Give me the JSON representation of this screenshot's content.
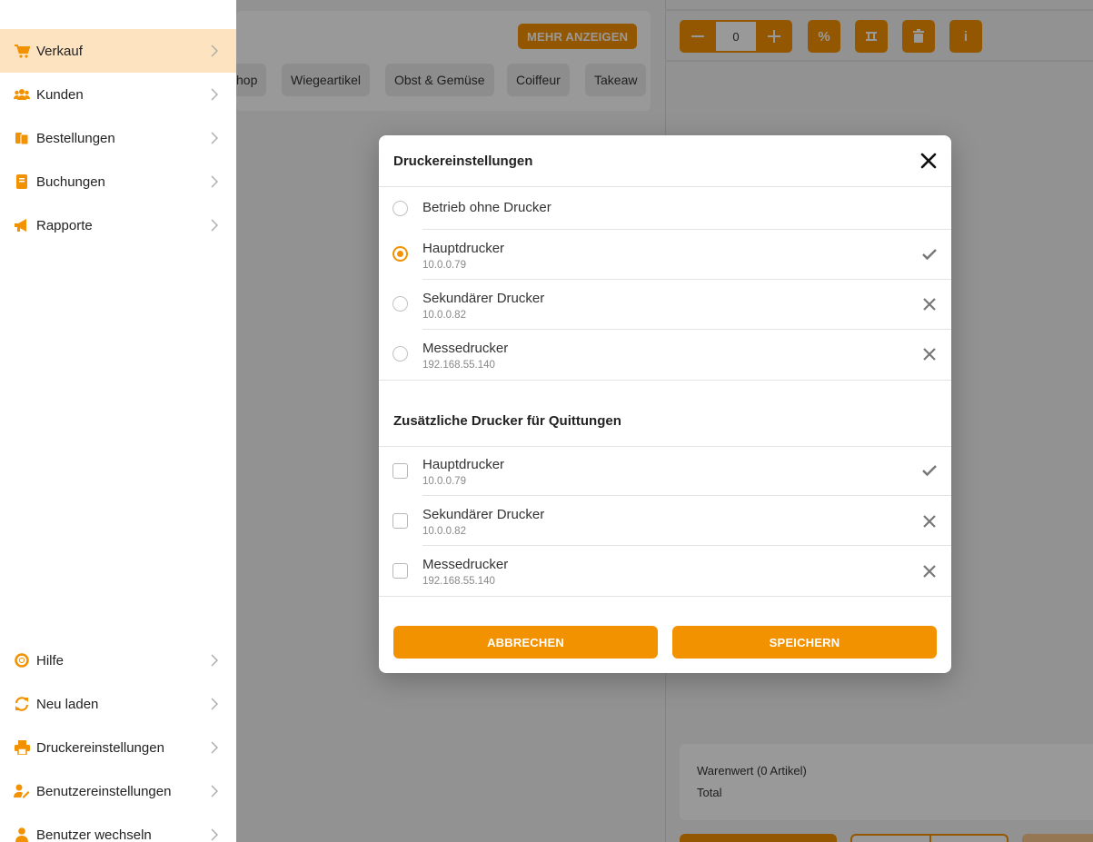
{
  "background": {
    "more_button": "MEHR ANZEIGEN",
    "categories": [
      "hop",
      "Wiegeartikel",
      "Obst & Gemüse",
      "Coiffeur",
      "Takeaw"
    ],
    "quantity": "0",
    "tools": [
      {
        "name": "percent-button",
        "label": "%"
      },
      {
        "name": "split-button",
        "label": ""
      },
      {
        "name": "trash-button",
        "label": ""
      },
      {
        "name": "info-button",
        "label": "i"
      }
    ],
    "summary": {
      "goods_value": "Warenwert (0 Artikel)",
      "total": "Total"
    }
  },
  "sidebar": {
    "items": [
      {
        "label": "Verkauf",
        "icon": "cart-icon"
      },
      {
        "label": "Kunden",
        "icon": "users-icon"
      },
      {
        "label": "Bestellungen",
        "icon": "orders-icon"
      },
      {
        "label": "Buchungen",
        "icon": "book-icon"
      },
      {
        "label": "Rapporte",
        "icon": "megaphone-icon"
      }
    ],
    "bottom_items": [
      {
        "label": "Hilfe",
        "icon": "lifebuoy-icon"
      },
      {
        "label": "Neu laden",
        "icon": "reload-icon"
      },
      {
        "label": "Druckereinstellungen",
        "icon": "printer-icon"
      },
      {
        "label": "Benutzereinstellungen",
        "icon": "user-settings-icon"
      },
      {
        "label": "Benutzer wechseln",
        "icon": "user-icon"
      }
    ]
  },
  "modal": {
    "title": "Druckereinstellungen",
    "no_printer_label": "Betrieb ohne Drucker",
    "printers": [
      {
        "name": "Hauptdrucker",
        "ip": "10.0.0.79",
        "selected": true,
        "online": true
      },
      {
        "name": "Sekundärer Drucker",
        "ip": "10.0.0.82",
        "selected": false,
        "online": false
      },
      {
        "name": "Messedrucker",
        "ip": "192.168.55.140",
        "selected": false,
        "online": false
      }
    ],
    "receipt_section_title": "Zusätzliche Drucker für Quittungen",
    "receipt_printers": [
      {
        "name": "Hauptdrucker",
        "ip": "10.0.0.79",
        "checked": false,
        "online": true
      },
      {
        "name": "Sekundärer Drucker",
        "ip": "10.0.0.82",
        "checked": false,
        "online": false
      },
      {
        "name": "Messedrucker",
        "ip": "192.168.55.140",
        "checked": false,
        "online": false
      }
    ],
    "cancel_label": "ABBRECHEN",
    "save_label": "SPEICHERN"
  },
  "colors": {
    "accent": "#f39200",
    "active_bg": "#fde3c0"
  }
}
